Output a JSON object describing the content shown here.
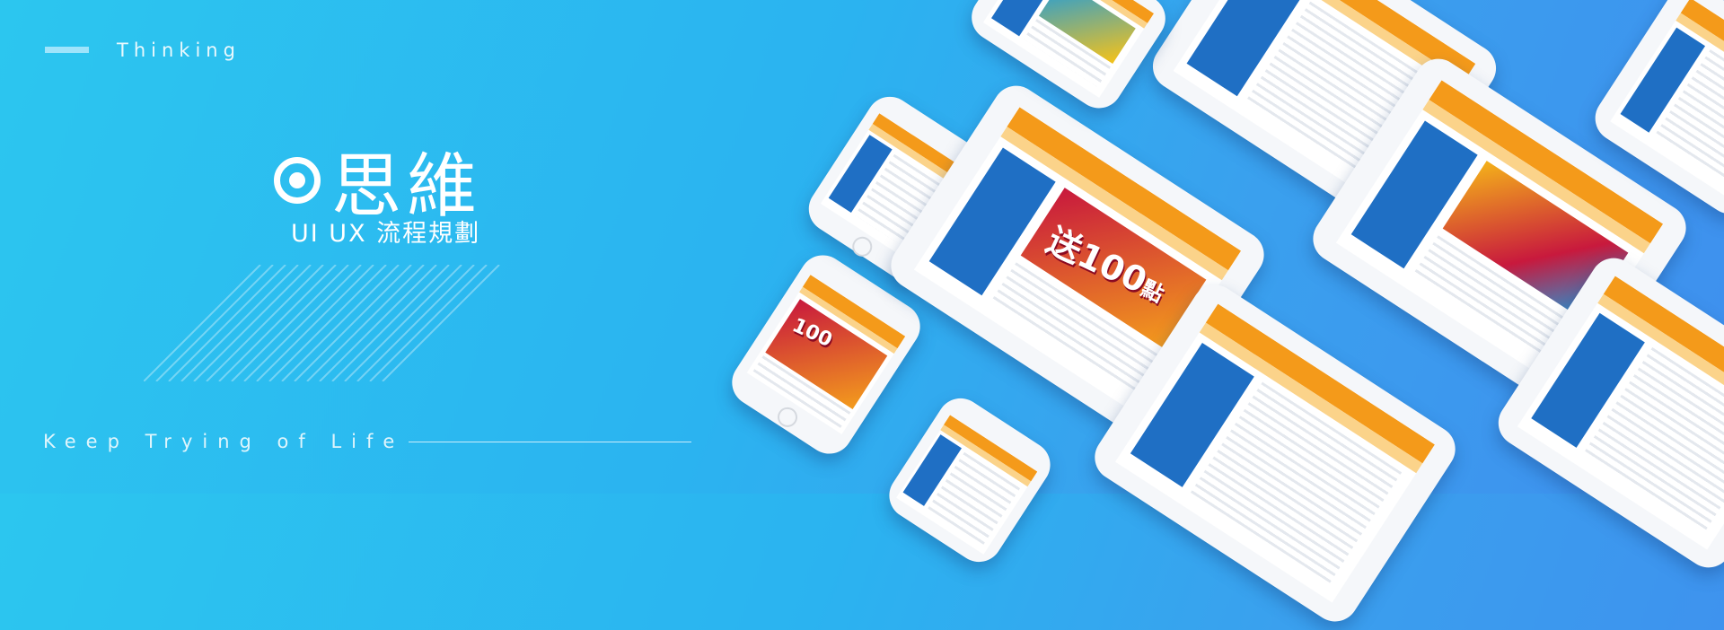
{
  "header": {
    "kicker": "Thinking"
  },
  "hero": {
    "title": "思維",
    "subtitle": "UI UX 流程規劃"
  },
  "footer": {
    "tagline": "Keep Trying of Life"
  },
  "banner": {
    "highlight": "100",
    "unit": "點",
    "prefix": "送"
  },
  "colors": {
    "accent_orange": "#f49a1a",
    "site_blue": "#1f6fc4",
    "background_start": "#2cc6ef",
    "background_end": "#3f8fee"
  }
}
